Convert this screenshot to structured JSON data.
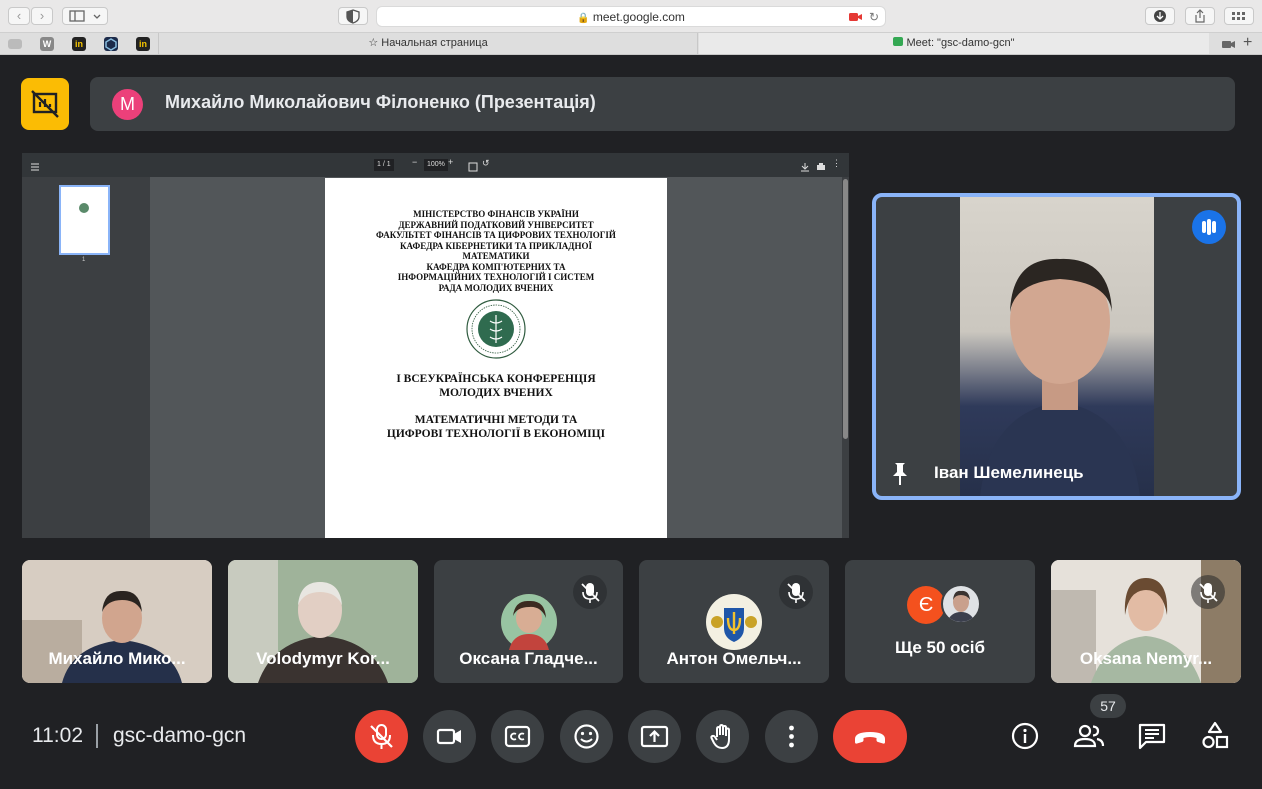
{
  "browser": {
    "url": "meet.google.com",
    "tabs": [
      "Начальная страница",
      "Meet: \"gsc-damo-gcn\""
    ],
    "favicons": [
      "W",
      "in",
      "in"
    ]
  },
  "presenter": {
    "initial": "M",
    "name": "Михайло Миколайович Філоненко (Презентація)"
  },
  "pdf_viewer": {
    "page_indicator": "1 / 1",
    "zoom": "100%",
    "thumb_label": "1"
  },
  "document": {
    "header_lines": [
      "МІНІСТЕРСТВО ФІНАНСІВ УКРАЇНИ",
      "ДЕРЖАВНИЙ ПОДАТКОВИЙ УНІВЕРСИТЕТ",
      "ФАКУЛЬТЕТ ФІНАНСІВ ТА ЦИФРОВИХ ТЕХНОЛОГІЙ",
      "КАФЕДРА КІБЕРНЕТИКИ ТА ПРИКЛАДНОЇ",
      "МАТЕМАТИКИ",
      "КАФЕДРА КОМП'ЮТЕРНИХ ТА",
      "ІНФОРМАЦІЙНИХ ТЕХНОЛОГІЙ І СИСТЕМ",
      "РАДА МОЛОДИХ ВЧЕНИХ"
    ],
    "conference_line1": "I ВСЕУКРАЇНСЬКА КОНФЕРЕНЦІЯ",
    "conference_line2": "МОЛОДИХ ВЧЕНИХ",
    "topic_line1": "МАТЕМАТИЧНІ МЕТОДИ ТА",
    "topic_line2": "ЦИФРОВІ ТЕХНОЛОГІЇ В ЕКОНОМІЦІ"
  },
  "speaker": {
    "name": "Іван Шемелинець"
  },
  "participants": [
    {
      "name": "Михайло Мико..."
    },
    {
      "name": "Volodymyr Kor..."
    },
    {
      "name": "Оксана Гладче..."
    },
    {
      "name": "Антон Омельч..."
    },
    {
      "name": "Ще 50 осіб",
      "avatar_letter": "Є"
    },
    {
      "name": "Oksana Nemyr..."
    }
  ],
  "bottom_bar": {
    "time": "11:02",
    "meeting_code": "gsc-damo-gcn",
    "participant_count": "57"
  },
  "colors": {
    "accent_blue": "#8ab4f8",
    "end_call_red": "#ea4335",
    "present_yellow": "#fbbc04"
  }
}
